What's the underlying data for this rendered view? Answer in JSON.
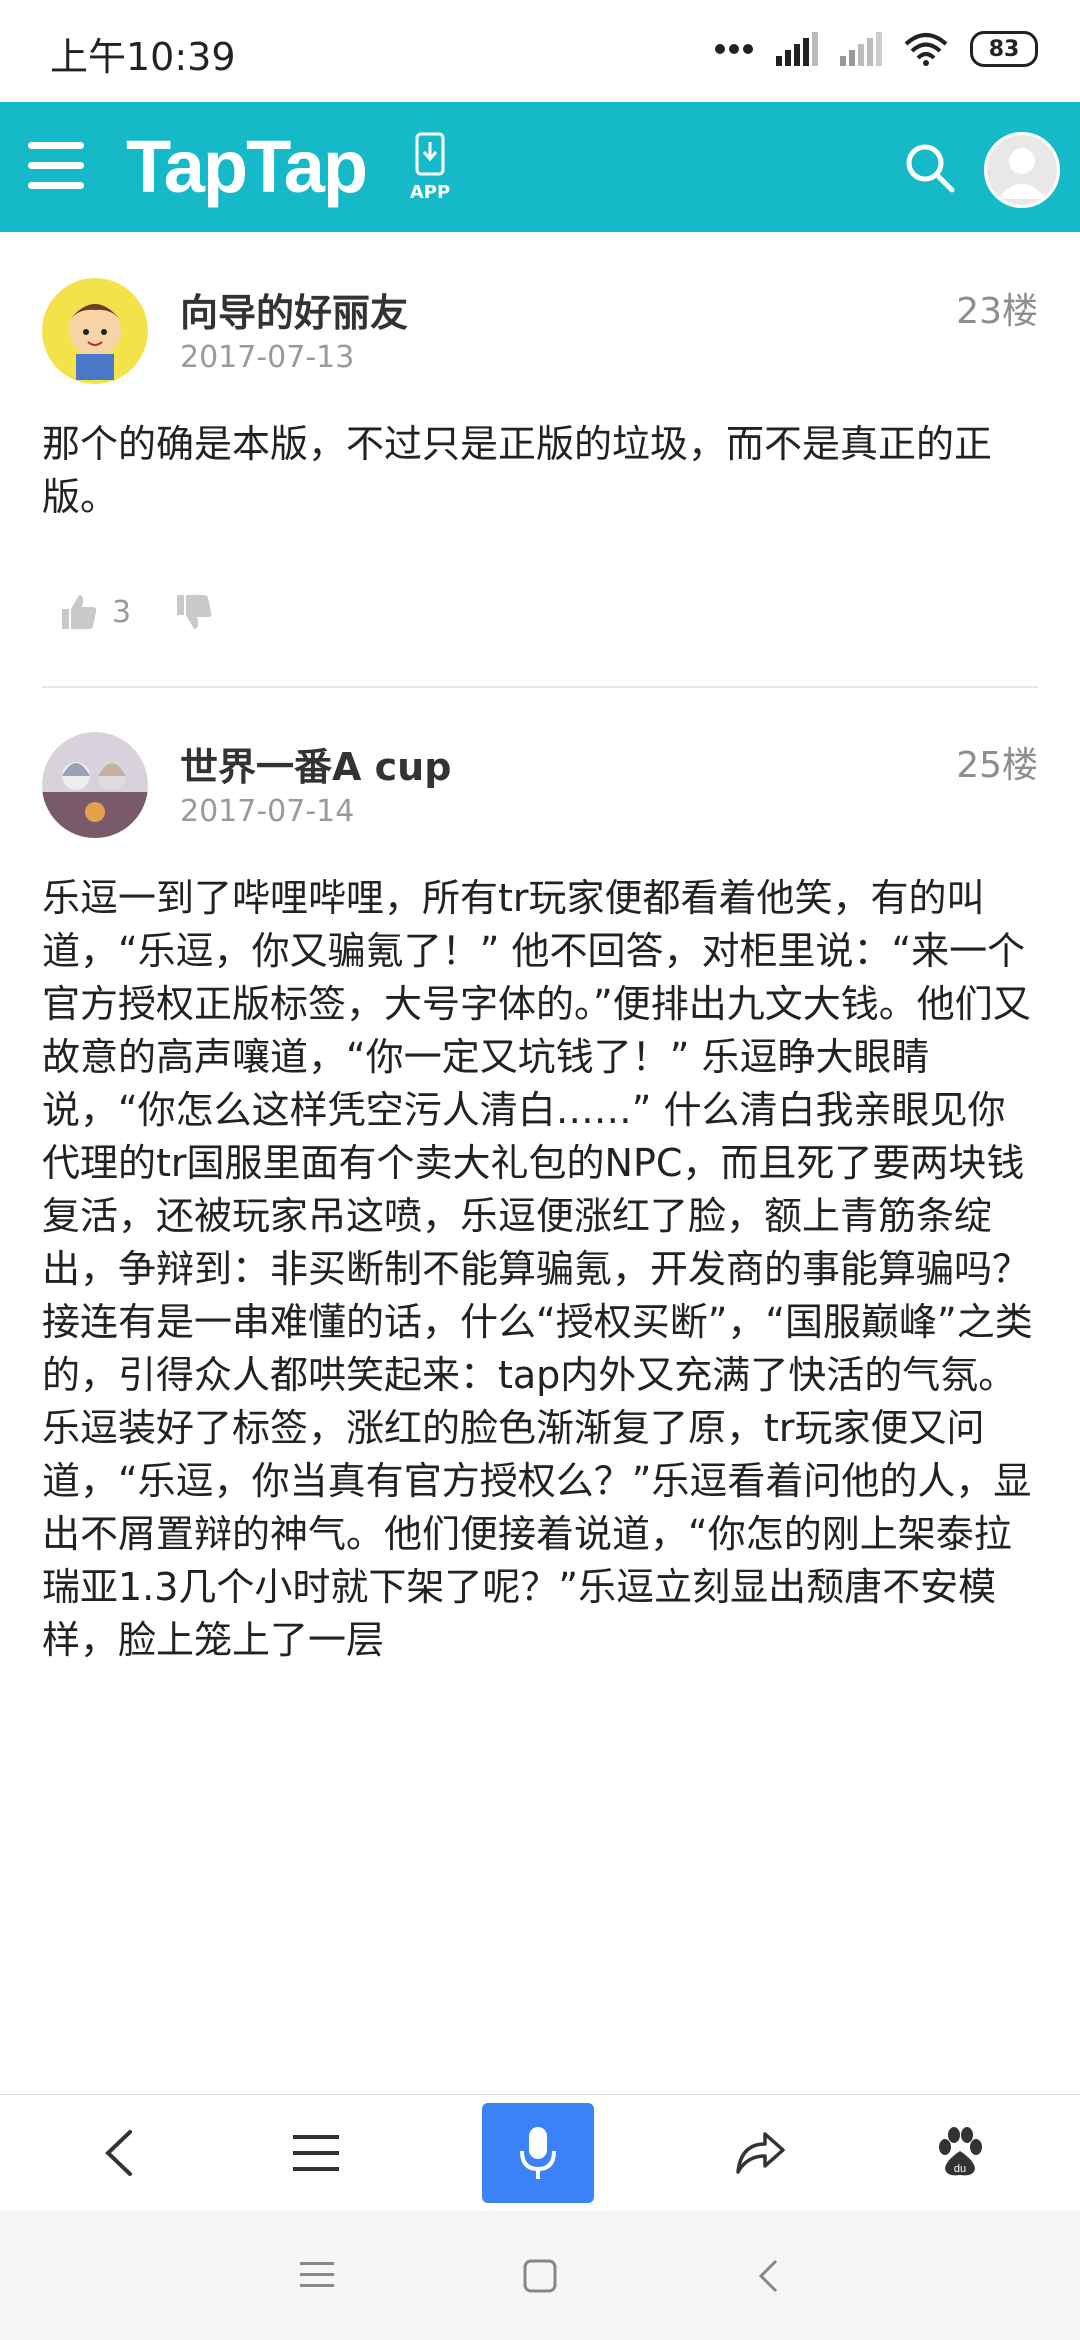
{
  "status_bar": {
    "time": "上午10:39",
    "battery": "83",
    "icons": [
      "more-dots-icon",
      "signal-icon",
      "signal-icon",
      "wifi-icon",
      "battery-icon"
    ]
  },
  "header": {
    "logo": "TapTap",
    "app_label": "APP",
    "accent": "#15b9c8"
  },
  "posts": [
    {
      "username": "向导的好丽友",
      "date": "2017-07-13",
      "floor": "23楼",
      "content": "那个的确是本版，不过只是正版的垃圾，而不是真正的正版。",
      "likes": "3"
    },
    {
      "username": "世界一番A cup",
      "date": "2017-07-14",
      "floor": "25楼",
      "content": "乐逗一到了哔哩哔哩，所有tr玩家便都看着他笑，有的叫道，“乐逗，你又骗氪了！” 他不回答，对柜里说：“来一个官方授权正版标签，大号字体的。”便排出九文大钱。他们又故意的高声嚷道，“你一定又坑钱了！” 乐逗睁大眼睛说，“你怎么这样凭空污人清白……” 什么清白我亲眼见你代理的tr国服里面有个卖大礼包的NPC，而且死了要两块钱复活，还被玩家吊这喷，乐逗便涨红了脸，额上青筋条绽出，争辩到：非买断制不能算骗氪，开发商的事能算骗吗？ 接连有是一串难懂的话，什么“授权买断”，“国服巅峰”之类的，引得众人都哄笑起来：tap内外又充满了快活的气氛。乐逗装好了标签，涨红的脸色渐渐复了原，tr玩家便又问道，“乐逗，你当真有官方授权么？”乐逗看着问他的人，显出不屑置辩的神气。他们便接着说道，“你怎的刚上架泰拉瑞亚1.3几个小时就下架了呢？”乐逗立刻显出颓唐不安模样，脸上笼上了一层"
    }
  ],
  "toolbar": {
    "items": [
      "back-icon",
      "menu-icon",
      "microphone-icon",
      "share-icon",
      "baidu-paw-icon"
    ],
    "voice_color": "#3b82f6"
  }
}
